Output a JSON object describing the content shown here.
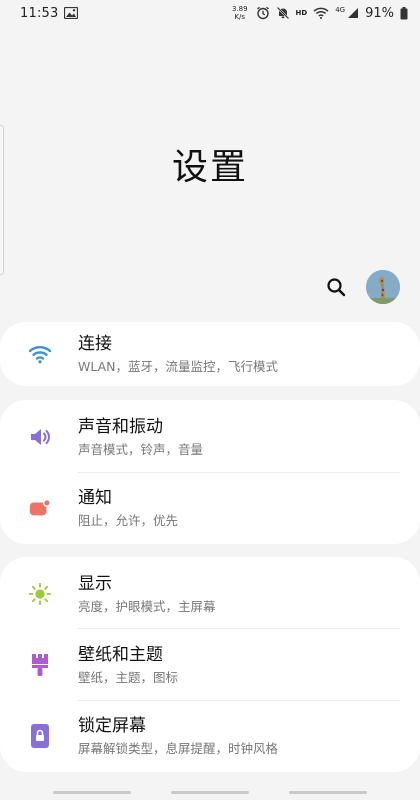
{
  "status_bar": {
    "time": "11:53",
    "net_speed_value": "3.89",
    "net_speed_unit": "K/s",
    "hd_label": "HD",
    "network_type": "4G",
    "battery": "91%",
    "icons": [
      "image-icon",
      "alarm-icon",
      "mute-icon",
      "wifi-icon",
      "signal-icon",
      "battery-icon"
    ]
  },
  "header": {
    "title": "设置"
  },
  "actions": {
    "search_icon": "search-icon",
    "avatar": "giraffe-avatar"
  },
  "groups": [
    {
      "items": [
        {
          "title": "连接",
          "subtitle": "WLAN，蓝牙，流量监控，飞行模式",
          "icon": "wifi-icon",
          "icon_color": "#3d8fd8"
        }
      ]
    },
    {
      "items": [
        {
          "title": "声音和振动",
          "subtitle": "声音模式，铃声，音量",
          "icon": "volume-icon",
          "icon_color": "#8a6fd8"
        },
        {
          "title": "通知",
          "subtitle": "阻止，允许，优先",
          "icon": "notification-icon",
          "icon_color": "#ee7268"
        }
      ]
    },
    {
      "items": [
        {
          "title": "显示",
          "subtitle": "亮度，护眼模式，主屏幕",
          "icon": "brightness-icon",
          "icon_color": "#9ec93a"
        },
        {
          "title": "壁纸和主题",
          "subtitle": "壁纸，主题，图标",
          "icon": "paintbrush-icon",
          "icon_color": "#b05ad0"
        },
        {
          "title": "锁定屏幕",
          "subtitle": "屏幕解锁类型，息屏提醒，时钟风格",
          "icon": "lock-icon",
          "icon_color": "#8a6fd8"
        }
      ]
    }
  ]
}
